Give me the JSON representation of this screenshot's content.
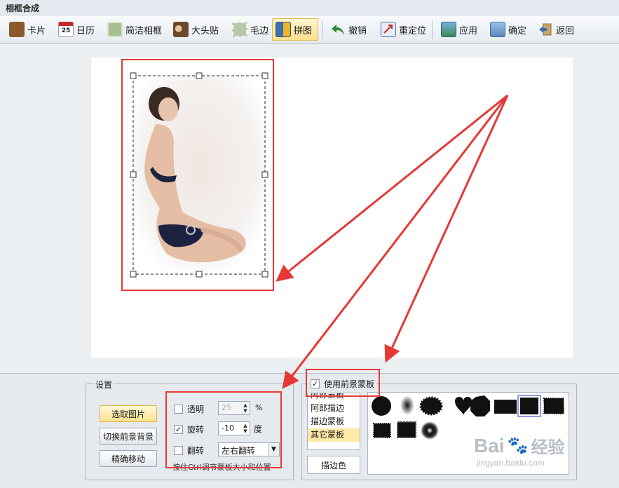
{
  "window": {
    "title": "相框合成"
  },
  "toolbar": {
    "items": [
      {
        "label": "卡片",
        "icon": "card-icon",
        "color": "#8a5a2b"
      },
      {
        "label": "日历",
        "icon": "calendar-icon",
        "color": "#c62828",
        "icon_text": "25"
      },
      {
        "label": "简洁相框",
        "icon": "simple-frame-icon",
        "color": "#a8c090"
      },
      {
        "label": "大头贴",
        "icon": "photo-sticker-icon",
        "color": "#7a5c3e"
      },
      {
        "label": "毛边",
        "icon": "rough-edge-icon",
        "color": "#b7c9a8"
      },
      {
        "label": "拼图",
        "icon": "puzzle-icon",
        "color": "#3a6fb0"
      },
      {
        "label": "撤销",
        "icon": "undo-icon",
        "color": "#2e8b3a"
      },
      {
        "label": "重定位",
        "icon": "reposition-icon",
        "color": "#3b6fb5"
      },
      {
        "label": "应用",
        "icon": "apply-icon",
        "color": "#3b8a4f"
      },
      {
        "label": "确定",
        "icon": "confirm-icon",
        "color": "#5a86b8"
      },
      {
        "label": "返回",
        "icon": "back-icon",
        "color": "#8a6a3a"
      }
    ],
    "active_index": 5
  },
  "settings": {
    "group_title": "设置",
    "select_image_label": "选取图片",
    "switch_bg_label": "切换前景背景",
    "fine_move_label": "精确移动",
    "transparent_label": "透明",
    "transparent_checked": false,
    "transparent_value": "25",
    "transparent_unit": "%",
    "rotate_label": "旋转",
    "rotate_checked": true,
    "rotate_value": "-10",
    "rotate_unit": "度",
    "flip_label": "翻转",
    "flip_checked": false,
    "flip_mode": "左右翻转",
    "hint": "按住Ctrl调节蒙板大小和位置"
  },
  "mask": {
    "use_foreground_label": "使用前景蒙板",
    "use_foreground_checked": true,
    "list": [
      "阿郎蒙板",
      "阿郎描边",
      "描边蒙板",
      "其它蒙板"
    ],
    "selected": "其它蒙板",
    "stroke_color_label": "描边色"
  },
  "watermark": {
    "brand": "Bai",
    "brand2": "经验",
    "url": "jingyan.baidu.com"
  },
  "colors": {
    "accent": "#e53935",
    "active_button": "#ffe08a"
  }
}
